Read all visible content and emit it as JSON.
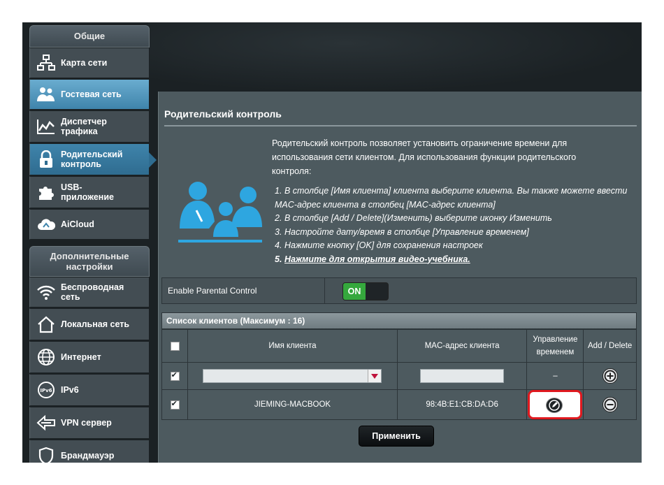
{
  "sidebar": {
    "general_header": "Общие",
    "general_items": [
      {
        "label": "Карта сети",
        "icon": "network-map-icon"
      },
      {
        "label": "Гостевая сеть",
        "icon": "guest-network-icon"
      },
      {
        "label": "Диспетчер трафика",
        "icon": "traffic-manager-icon"
      },
      {
        "label": "Родительский контроль",
        "icon": "parental-control-icon"
      },
      {
        "label": "USB-приложение",
        "icon": "usb-app-icon"
      },
      {
        "label": "AiCloud",
        "icon": "aicloud-icon"
      }
    ],
    "advanced_header": "Дополнительные настройки",
    "advanced_items": [
      {
        "label": "Беспроводная сеть",
        "icon": "wireless-icon"
      },
      {
        "label": "Локальная сеть",
        "icon": "lan-icon"
      },
      {
        "label": "Интернет",
        "icon": "internet-globe-icon"
      },
      {
        "label": "IPv6",
        "icon": "ipv6-icon"
      },
      {
        "label": "VPN сервер",
        "icon": "vpn-icon"
      },
      {
        "label": "Брандмауэр",
        "icon": "firewall-icon"
      }
    ]
  },
  "main": {
    "title": "Родительский контроль",
    "description": "Родительский контроль позволяет установить ограничение времени для использования сети клиентом. Для использования функции родительского контроля:",
    "steps": [
      "В столбце [Имя клиента] клиента выберите клиента. Вы также можете ввести MAC-адрес клиента в столбец [MAC-адрес клиента]",
      "В столбце [Add / Delete](Изменить) выберите иконку Изменить",
      "Настройте дату/время в столбце [Управление временем]",
      "Нажмите кнопку [OK] для сохранения настроек",
      "Нажмите для открытия видео-учебника."
    ],
    "step_numbers": [
      "1.",
      "2.",
      "3.",
      "4.",
      "5."
    ],
    "enable_label": "Enable Parental Control",
    "toggle_on": "ON",
    "table_title": "Список клиентов (Максимум : 16)",
    "columns": {
      "client_name": "Имя клиента",
      "mac": "MAC-адрес клиента",
      "time_mgmt": "Управление временем",
      "add_delete": "Add / Delete"
    },
    "new_row": {
      "time_mgmt": "–"
    },
    "rows": [
      {
        "client_name": "JIEMING-MACBOOK",
        "mac": "98:4B:E1:CB:DA:D6"
      }
    ],
    "apply_button": "Применить"
  },
  "colors": {
    "accent_blue": "#3f84ab",
    "toggle_green": "#35a83d",
    "highlight_red": "#e0191f",
    "panel_bg": "#4d5a5f"
  }
}
